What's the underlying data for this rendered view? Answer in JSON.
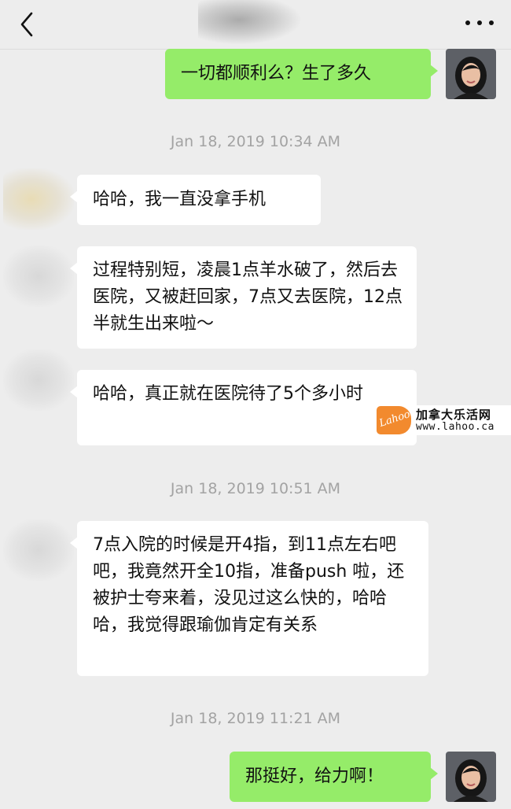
{
  "header": {
    "back_icon": "chevron-left-icon",
    "more_icon": "more-dots-icon"
  },
  "messages": [
    {
      "side": "out",
      "text": "一切都顺利么？生了多久"
    },
    {
      "side": "in",
      "text": "哈哈，我一直没拿手机"
    },
    {
      "side": "in",
      "text": "过程特别短，凌晨1点羊水破了，然后去医院，又被赶回家，7点又去医院，12点半就生出来啦～"
    },
    {
      "side": "in",
      "text": "哈哈，真正就在医院待了5个多小时"
    },
    {
      "side": "in",
      "text": "7点入院的时候是开4指，到11点左右吧吧，我竟然开全10指，准备push 啦，还被护士夸来着，没见过这么快的，哈哈哈，我觉得跟瑜伽肯定有关系"
    },
    {
      "side": "out",
      "text": "那挺好，给力啊！"
    }
  ],
  "timestamps": [
    "Jan 18, 2019 10:34 AM",
    "Jan 18, 2019 10:51 AM",
    "Jan 18, 2019 11:21 AM"
  ],
  "watermark": {
    "logo_text": "Lahoo",
    "title": "加拿大乐活网",
    "url": "www.lahoo.ca"
  },
  "colors": {
    "background": "#ededed",
    "outgoing_bubble": "#95ec69",
    "incoming_bubble": "#ffffff",
    "timestamp": "#a3a3a3",
    "watermark_orange": "#f28a2e"
  }
}
